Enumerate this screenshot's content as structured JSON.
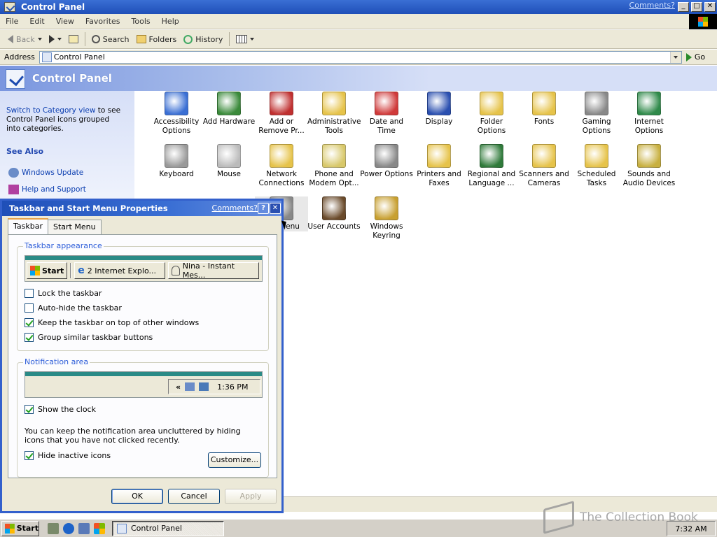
{
  "window": {
    "title": "Control Panel",
    "comments_link": "Comments?"
  },
  "menu": [
    "File",
    "Edit",
    "View",
    "Favorites",
    "Tools",
    "Help"
  ],
  "toolbar": {
    "back": "Back",
    "search": "Search",
    "folders": "Folders",
    "history": "History"
  },
  "address": {
    "label": "Address",
    "value": "Control Panel",
    "go": "Go"
  },
  "header": {
    "title": "Control Panel"
  },
  "sidebar": {
    "switch_link": "Switch to Category view",
    "switch_rest": " to see Control Panel icons grouped into categories.",
    "see_also": "See Also",
    "links": [
      "Windows Update",
      "Help and Support"
    ]
  },
  "icons": [
    {
      "label": "Accessibility Options",
      "icon": "accessibility-icon",
      "color": "#3a6fd4"
    },
    {
      "label": "Add Hardware",
      "icon": "hardware-icon",
      "color": "#3a8a3a"
    },
    {
      "label": "Add or Remove Pr...",
      "icon": "add-remove-icon",
      "color": "#c03030"
    },
    {
      "label": "Administrative Tools",
      "icon": "admin-tools-icon",
      "color": "#e6c34a"
    },
    {
      "label": "Date and Time",
      "icon": "clock-icon",
      "color": "#d03a3a"
    },
    {
      "label": "Display",
      "icon": "monitor-icon",
      "color": "#2a4fb0"
    },
    {
      "label": "Folder Options",
      "icon": "folder-options-icon",
      "color": "#e6c34a"
    },
    {
      "label": "Fonts",
      "icon": "fonts-icon",
      "color": "#e6c34a"
    },
    {
      "label": "Gaming Options",
      "icon": "joystick-icon",
      "color": "#888888"
    },
    {
      "label": "Internet Options",
      "icon": "globe-icon",
      "color": "#2f8a4a"
    },
    {
      "label": "Keyboard",
      "icon": "keyboard-icon",
      "color": "#999999"
    },
    {
      "label": "Mouse",
      "icon": "mouse-icon",
      "color": "#bbbbbb"
    },
    {
      "label": "Network Connections",
      "icon": "network-icon",
      "color": "#e6c34a"
    },
    {
      "label": "Phone and Modem Opt...",
      "icon": "phone-icon",
      "color": "#d8c86a"
    },
    {
      "label": "Power Options",
      "icon": "power-icon",
      "color": "#888888"
    },
    {
      "label": "Printers and Faxes",
      "icon": "printer-icon",
      "color": "#e6c34a"
    },
    {
      "label": "Regional and Language ...",
      "icon": "globe-icon",
      "color": "#2f7a3a"
    },
    {
      "label": "Scanners and Cameras",
      "icon": "camera-icon",
      "color": "#e6c34a"
    },
    {
      "label": "Scheduled Tasks",
      "icon": "tasks-icon",
      "color": "#e6c34a"
    },
    {
      "label": "Sounds and Audio Devices",
      "icon": "speaker-icon",
      "color": "#c8b040"
    },
    {
      "label": "and Menu",
      "icon": "taskbar-icon",
      "color": "#888888"
    },
    {
      "label": "User Accounts",
      "icon": "user-icon",
      "color": "#6a4a2a"
    },
    {
      "label": "Windows Keyring",
      "icon": "keyring-icon",
      "color": "#c8a030"
    }
  ],
  "dialog": {
    "title": "Taskbar and Start Menu Properties",
    "comments": "Comments?",
    "tabs": [
      "Taskbar",
      "Start Menu"
    ],
    "appearance_legend": "Taskbar appearance",
    "preview": {
      "start": "Start",
      "ie": "2 Internet Explo...",
      "im": "Nina - Instant Mes..."
    },
    "options": [
      {
        "label": "Lock the taskbar",
        "checked": false
      },
      {
        "label": "Auto-hide the taskbar",
        "checked": false
      },
      {
        "label": "Keep the taskbar on top of other windows",
        "checked": true
      },
      {
        "label": "Group similar taskbar buttons",
        "checked": true
      }
    ],
    "notification_legend": "Notification area",
    "tray_chevron": "«",
    "tray_time": "1:36 PM",
    "show_clock": {
      "label": "Show the clock",
      "checked": true
    },
    "hint": "You can keep the notification area uncluttered by hiding icons that you have not clicked recently.",
    "hide_inactive": {
      "label": "Hide inactive icons",
      "checked": true
    },
    "customize": "Customize...",
    "ok": "OK",
    "cancel": "Cancel",
    "apply": "Apply"
  },
  "taskbar": {
    "start": "Start",
    "task": "Control Panel",
    "clock": "7:32 AM"
  },
  "watermark": "The Collection Book"
}
